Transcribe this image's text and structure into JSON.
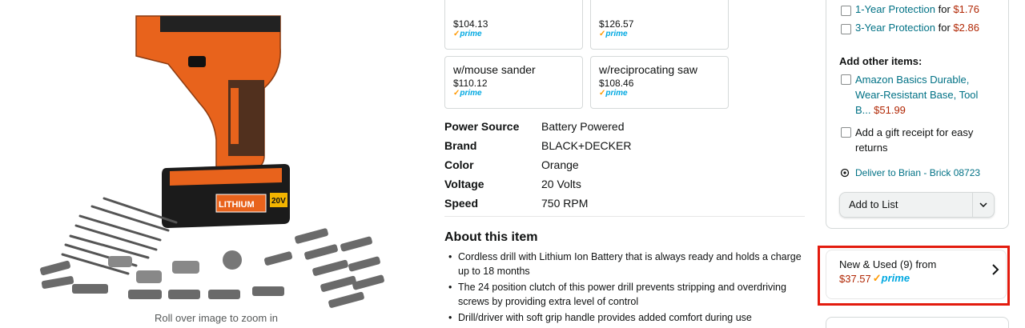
{
  "product_image": {
    "zoom_hint": "Roll over image to zoom in",
    "battery_brand_text": "LITHIUM",
    "battery_voltage_text": "20V"
  },
  "variants": [
    {
      "name": "",
      "price": "$104.13",
      "prime": "prime"
    },
    {
      "name": "",
      "price": "$126.57",
      "prime": "prime"
    },
    {
      "name": "w/mouse sander",
      "price": "$110.12",
      "prime": "prime"
    },
    {
      "name": "w/reciprocating saw",
      "price": "$108.46",
      "prime": "prime"
    }
  ],
  "specs": [
    {
      "key": "Power Source",
      "value": "Battery Powered"
    },
    {
      "key": "Brand",
      "value": "BLACK+DECKER"
    },
    {
      "key": "Color",
      "value": "Orange"
    },
    {
      "key": "Voltage",
      "value": "20 Volts"
    },
    {
      "key": "Speed",
      "value": "750 RPM"
    }
  ],
  "about": {
    "title": "About this item",
    "bullets": [
      "Cordless drill with Lithium Ion Battery that is always ready and holds a charge up to 18 months",
      "The 24 position clutch of this power drill prevents stripping and overdriving screws by providing extra level of control",
      "Drill/driver with soft grip handle provides added comfort during use"
    ]
  },
  "buybox": {
    "protection_partial": {
      "label": "1-Year Protection",
      "for": "for",
      "price": "$1.76"
    },
    "protection_3yr": {
      "label": "3-Year Protection",
      "for": "for",
      "price": "$2.86"
    },
    "add_other_title": "Add other items:",
    "other_item": {
      "label": "Amazon Basics Durable, Wear-Resistant Base, Tool B...",
      "price": "$51.99"
    },
    "gift_receipt": "Add a gift receipt for easy returns",
    "deliver_to": "Deliver to Brian - Brick 08723",
    "add_to_list": "Add to List",
    "new_used": {
      "text": "New & Used (9) from",
      "price": "$37.57",
      "prime": "prime"
    }
  },
  "colors": {
    "link": "#007185",
    "price_red": "#b12704",
    "prime_blue": "#00a8e1",
    "prime_check": "#ff9900",
    "drill_orange": "#e8631c",
    "highlight_red": "#e31b0e"
  },
  "icons": [
    "location-pin-icon",
    "chevron-down-icon",
    "chevron-right-icon",
    "checkbox-icon"
  ]
}
